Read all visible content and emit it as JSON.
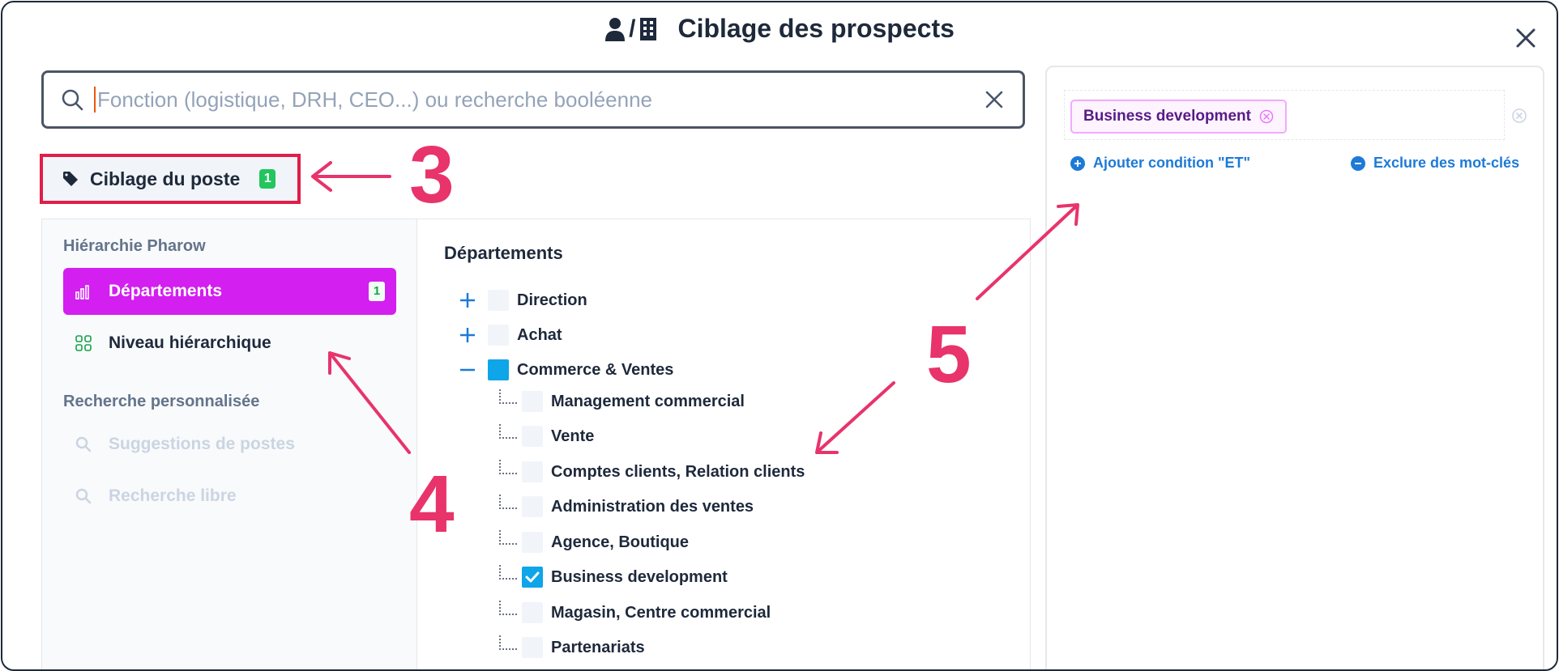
{
  "modal": {
    "title": "Ciblage des prospects",
    "title_icons": [
      "person-icon",
      "building-icon"
    ],
    "icon_separator": "/"
  },
  "search": {
    "placeholder": "Fonction (logistique, DRH, CEO...) ou recherche booléenne",
    "value": ""
  },
  "ciblage_button": {
    "label": "Ciblage du poste",
    "badge": "1"
  },
  "left_nav": {
    "section1": "Hiérarchie Pharow",
    "items1": [
      {
        "label": "Départements",
        "badge": "1",
        "active": true,
        "icon": "chart-bars-icon"
      },
      {
        "label": "Niveau hiérarchique",
        "active": false,
        "icon": "grid-icon"
      }
    ],
    "section2": "Recherche personnalisée",
    "items2": [
      {
        "label": "Suggestions de postes",
        "icon": "search-icon"
      },
      {
        "label": "Recherche libre",
        "icon": "search-icon"
      }
    ]
  },
  "departments": {
    "title": "Départements",
    "top": [
      {
        "label": "Direction",
        "state": "collapsed"
      },
      {
        "label": "Achat",
        "state": "collapsed"
      },
      {
        "label": "Commerce & Ventes",
        "state": "expanded"
      }
    ],
    "children": [
      {
        "label": "Management commercial",
        "checked": false
      },
      {
        "label": "Vente",
        "checked": false
      },
      {
        "label": "Comptes clients, Relation clients",
        "checked": false
      },
      {
        "label": "Administration des ventes",
        "checked": false
      },
      {
        "label": "Agence, Boutique",
        "checked": false
      },
      {
        "label": "Business development",
        "checked": true
      },
      {
        "label": "Magasin, Centre commercial",
        "checked": false
      },
      {
        "label": "Partenariats",
        "checked": false
      }
    ]
  },
  "selection": {
    "chips": [
      "Business development"
    ],
    "add_and": "Ajouter condition \"ET\"",
    "exclude": "Exclure des mot-clés"
  },
  "annotations": [
    "3",
    "4",
    "5"
  ],
  "colors": {
    "accent_magenta": "#d31ff0",
    "annotation": "#e8336b",
    "link_blue": "#1d7ad8",
    "check_blue": "#0ea5e9",
    "badge_green": "#22c55e"
  }
}
